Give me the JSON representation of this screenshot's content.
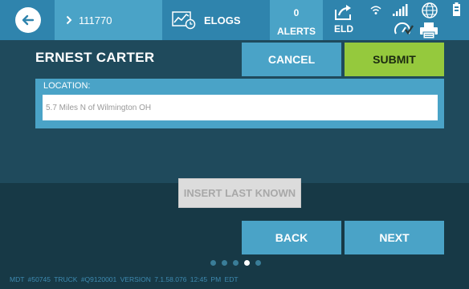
{
  "header": {
    "truck_id": "111770",
    "elogs_label": "ELOGS",
    "alerts_count": "0",
    "alerts_label": "ALERTS",
    "eld_label": "ELD",
    "icons": [
      "back-arrow-icon",
      "chevron-right-icon",
      "elogs-chart-icon",
      "share-arrow-icon",
      "wifi-icon",
      "signal-bars-icon",
      "globe-icon",
      "battery-icon",
      "gauge-check-icon",
      "printer-icon"
    ]
  },
  "driver": {
    "name": "ERNEST CARTER"
  },
  "actions": {
    "cancel": "CANCEL",
    "submit": "SUBMIT"
  },
  "location": {
    "label": "LOCATION:",
    "value": "5.7 Miles N of Wilmington OH"
  },
  "insert_last_known": "INSERT LAST KNOWN",
  "nav": {
    "back": "BACK",
    "next": "NEXT"
  },
  "pager": {
    "total": 5,
    "current": 4
  },
  "footer": {
    "text": "MDT #50745   TRUCK #Q9120001   VERSION  7.1.58.076   12:45 PM EDT"
  },
  "colors": {
    "accent": "#4aa3c7",
    "accent_dark": "#2f84ad",
    "submit": "#95c93d",
    "background": "#173946"
  }
}
